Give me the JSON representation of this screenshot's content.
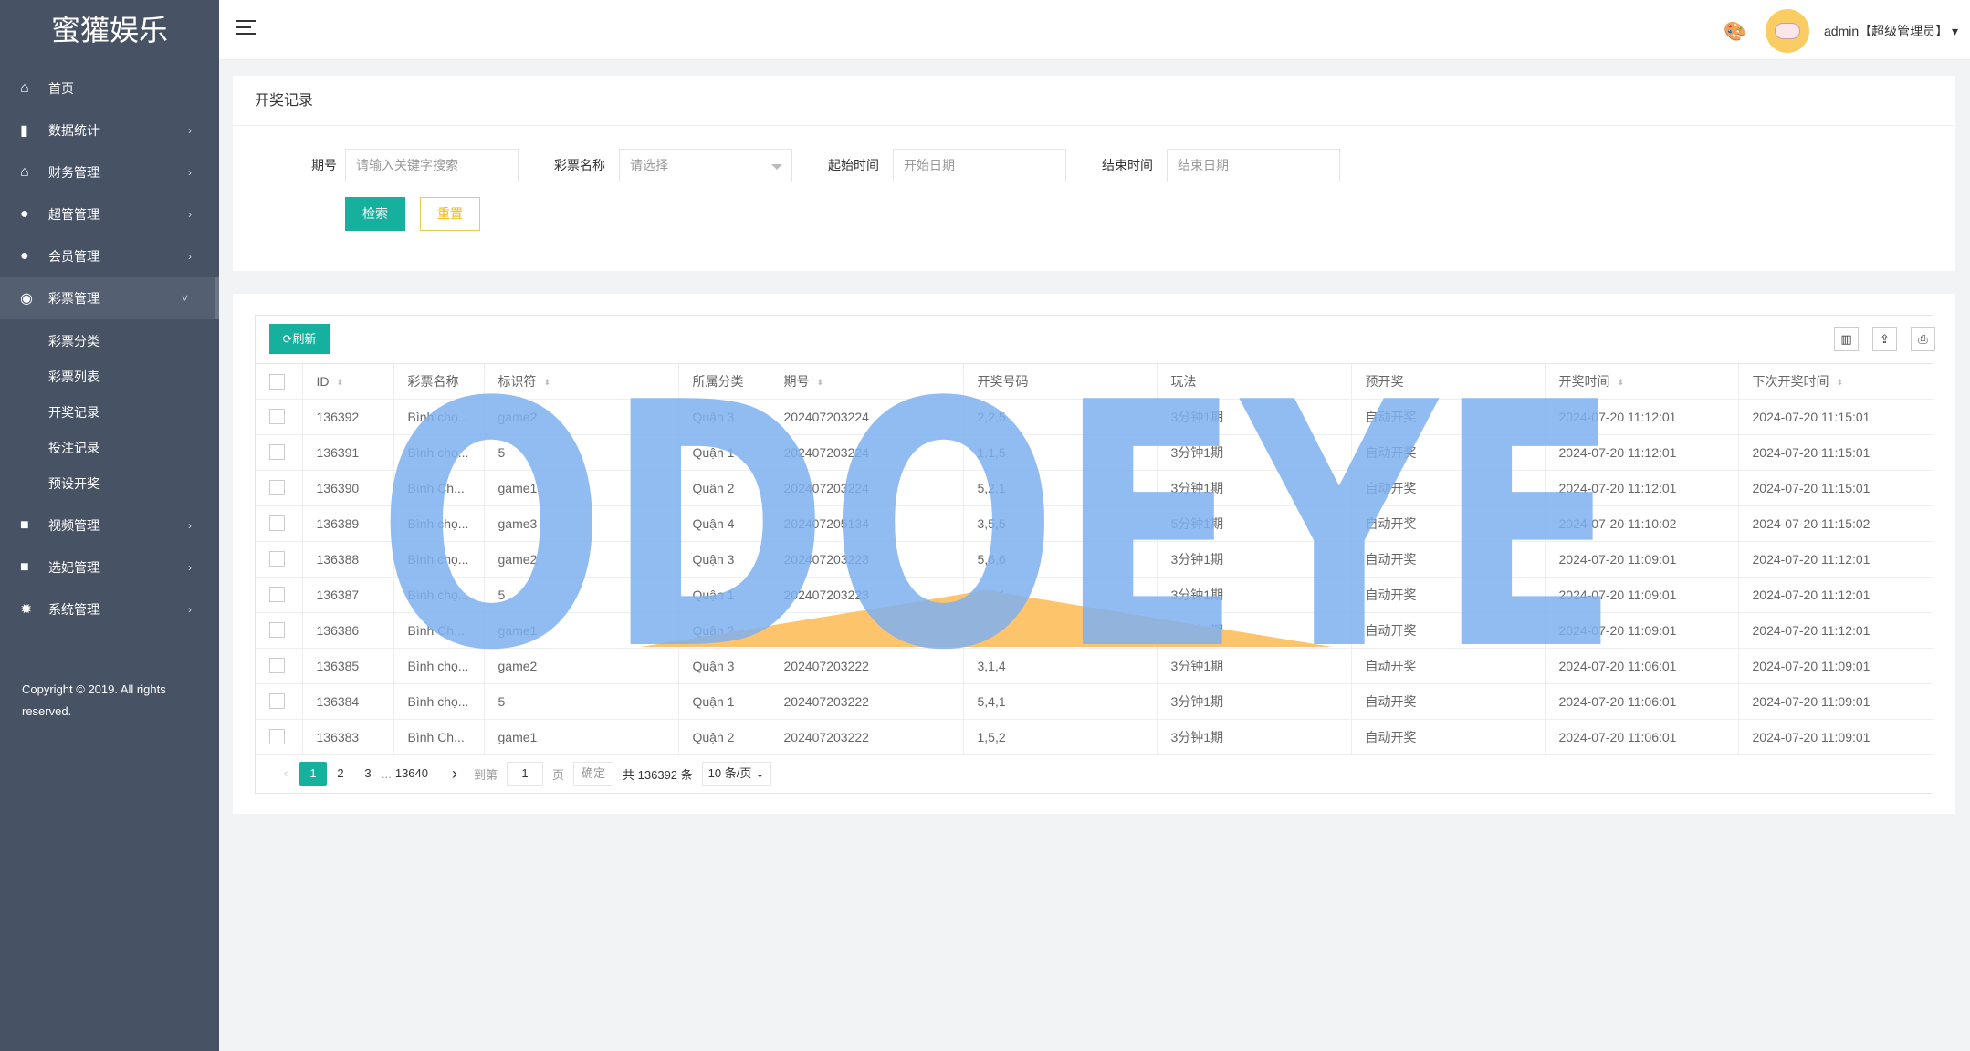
{
  "sidebar": {
    "logo": "蜜獾娱乐",
    "items": [
      {
        "label": "首页",
        "icon": "home-icon",
        "glyph": "⌂",
        "chev": ""
      },
      {
        "label": "数据统计",
        "icon": "bar-chart-icon",
        "glyph": "▮",
        "chev": "›"
      },
      {
        "label": "财务管理",
        "icon": "bank-icon",
        "glyph": "⌂",
        "chev": "›"
      },
      {
        "label": "超管管理",
        "icon": "user-icon",
        "glyph": "●",
        "chev": "›"
      },
      {
        "label": "会员管理",
        "icon": "users-icon",
        "glyph": "●",
        "chev": "›"
      },
      {
        "label": "彩票管理",
        "icon": "gamepad-icon",
        "glyph": "◉",
        "chev": "˅",
        "active": true
      }
    ],
    "subitems": [
      "彩票分类",
      "彩票列表",
      "开奖记录",
      "投注记录",
      "预设开奖"
    ],
    "items2": [
      {
        "label": "视频管理",
        "icon": "video-icon",
        "glyph": "■",
        "chev": "›"
      },
      {
        "label": "选妃管理",
        "icon": "video-icon",
        "glyph": "■",
        "chev": "›"
      },
      {
        "label": "系统管理",
        "icon": "gear-icon",
        "glyph": "✹",
        "chev": "›"
      }
    ],
    "copyright": "Copyright © 2019. All rights reserved."
  },
  "header": {
    "user": "admin【超级管理员】",
    "dropdown": "▾",
    "palette_glyph": "🎨"
  },
  "search": {
    "title": "开奖记录",
    "fields": [
      {
        "label": "期号",
        "placeholder": "请输入关键字搜索"
      },
      {
        "label": "彩票名称",
        "placeholder": "请选择"
      },
      {
        "label": "起始时间",
        "placeholder": "开始日期"
      },
      {
        "label": "结束时间",
        "placeholder": "结束日期"
      }
    ],
    "search_btn": "检索",
    "reset_btn": "重置"
  },
  "table": {
    "refresh": "⟳刷新",
    "tools": [
      {
        "icon": "columns-icon",
        "glyph": "▥"
      },
      {
        "icon": "export-icon",
        "glyph": "⇪"
      },
      {
        "icon": "print-icon",
        "glyph": "⎙"
      }
    ],
    "columns": [
      {
        "label": "ID",
        "sort": true
      },
      {
        "label": "彩票名称"
      },
      {
        "label": "标识符",
        "sort": true
      },
      {
        "label": "所属分类"
      },
      {
        "label": "期号",
        "sort": true
      },
      {
        "label": "开奖号码"
      },
      {
        "label": "玩法"
      },
      {
        "label": "预开奖"
      },
      {
        "label": "开奖时间",
        "sort": true
      },
      {
        "label": "下次开奖时间",
        "sort": true
      }
    ],
    "rows": [
      [
        "136392",
        "Bình chọ...",
        "game2",
        "Quận 3",
        "202407203224",
        "2,2,5",
        "3分钟1期",
        "自动开奖",
        "2024-07-20 11:12:01",
        "2024-07-20 11:15:01"
      ],
      [
        "136391",
        "Bình chọ...",
        "5",
        "Quận 1",
        "202407203224",
        "1,1,5",
        "3分钟1期",
        "自动开奖",
        "2024-07-20 11:12:01",
        "2024-07-20 11:15:01"
      ],
      [
        "136390",
        "Bình Ch...",
        "game1",
        "Quận 2",
        "202407203224",
        "5,2,1",
        "3分钟1期",
        "自动开奖",
        "2024-07-20 11:12:01",
        "2024-07-20 11:15:01"
      ],
      [
        "136389",
        "Bình chọ...",
        "game3",
        "Quận 4",
        "202407205134",
        "3,5,5",
        "5分钟1期",
        "自动开奖",
        "2024-07-20 11:10:02",
        "2024-07-20 11:15:02"
      ],
      [
        "136388",
        "Bình chọ...",
        "game2",
        "Quận 3",
        "202407203223",
        "5,6,6",
        "3分钟1期",
        "自动开奖",
        "2024-07-20 11:09:01",
        "2024-07-20 11:12:01"
      ],
      [
        "136387",
        "Bình chọ...",
        "5",
        "Quận 1",
        "202407203223",
        "5,1,1",
        "3分钟1期",
        "自动开奖",
        "2024-07-20 11:09:01",
        "2024-07-20 11:12:01"
      ],
      [
        "136386",
        "Bình Ch...",
        "game1",
        "Quận 2",
        "202407203223",
        "3,6,4",
        "3分钟1期",
        "自动开奖",
        "2024-07-20 11:09:01",
        "2024-07-20 11:12:01"
      ],
      [
        "136385",
        "Bình chọ...",
        "game2",
        "Quận 3",
        "202407203222",
        "3,1,4",
        "3分钟1期",
        "自动开奖",
        "2024-07-20 11:06:01",
        "2024-07-20 11:09:01"
      ],
      [
        "136384",
        "Bình chọ...",
        "5",
        "Quận 1",
        "202407203222",
        "5,4,1",
        "3分钟1期",
        "自动开奖",
        "2024-07-20 11:06:01",
        "2024-07-20 11:09:01"
      ],
      [
        "136383",
        "Bình Ch...",
        "game1",
        "Quận 2",
        "202407203222",
        "1,5,2",
        "3分钟1期",
        "自动开奖",
        "2024-07-20 11:06:01",
        "2024-07-20 11:09:01"
      ]
    ]
  },
  "pagination": {
    "prev": "‹",
    "pages": [
      "1",
      "2",
      "3"
    ],
    "ellipsis": "...",
    "last": "13640",
    "next": "›",
    "goto_label": "到第",
    "goto_value": "1",
    "page_unit": "页",
    "confirm": "确定",
    "total": "共 136392 条",
    "per_page": "10 条/页"
  },
  "watermark": {
    "text": "ODOEYE",
    "blue": "#7eb0f0",
    "orange": "#fdc46b"
  },
  "colors": {
    "accent": "#16b09f",
    "sidebar": "#475264",
    "reset": "#f5b400"
  }
}
